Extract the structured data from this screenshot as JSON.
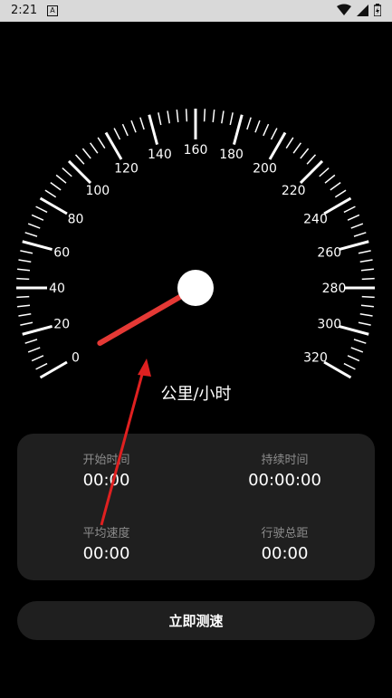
{
  "status_bar": {
    "time": "2:21",
    "notification_icon": "A",
    "icons": [
      "wifi-icon",
      "signal-icon",
      "battery-charging-icon"
    ]
  },
  "gauge": {
    "max_speed": 320,
    "current_speed": 0,
    "tick_labels": [
      "0",
      "20",
      "40",
      "60",
      "80",
      "100",
      "120",
      "140",
      "160",
      "180",
      "200",
      "220",
      "240",
      "260",
      "280",
      "300",
      "320"
    ],
    "unit": "公里/小时",
    "needle_color": "#e53935",
    "hub_color": "#ffffff"
  },
  "stats": {
    "start_time": {
      "label": "开始时间",
      "value": "00:00"
    },
    "duration": {
      "label": "持续时间",
      "value": "00:00:00"
    },
    "avg_speed": {
      "label": "平均速度",
      "value": "00:00"
    },
    "distance": {
      "label": "行驶总距",
      "value": "00:00"
    }
  },
  "action": {
    "start_label": "立即测速"
  },
  "annotation": {
    "color": "#e02020"
  }
}
